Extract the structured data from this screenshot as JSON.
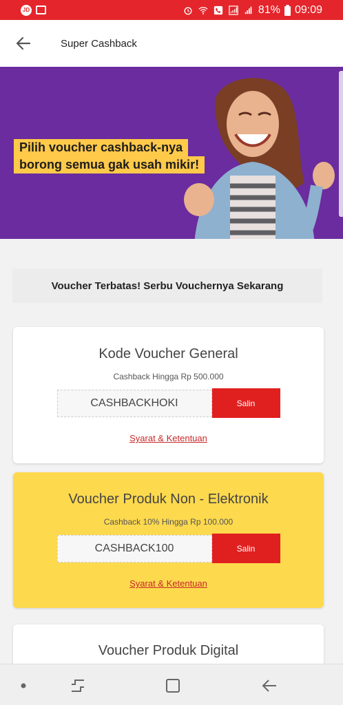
{
  "status_bar": {
    "left_badges": [
      "JD",
      ""
    ],
    "battery": "81%",
    "time": "09:09",
    "icons": [
      "alarm-icon",
      "wifi-icon",
      "phone-icon",
      "signal-icon",
      "battery-icon"
    ]
  },
  "header": {
    "title": "Super Cashback",
    "back_icon": "arrow-left-icon"
  },
  "banner": {
    "line1": "Pilih voucher cashback-nya",
    "line2": "borong semua gak usah mikir!",
    "colors": {
      "background": "#6a2c9e",
      "highlight": "#ffc94a"
    }
  },
  "info": {
    "text": "Voucher Terbatas! Serbu Vouchernya Sekarang"
  },
  "vouchers": [
    {
      "title": "Kode Voucher General",
      "subtitle": "Cashback Hingga Rp 500.000",
      "code": "CASHBACKHOKI",
      "button": "Salin",
      "terms": "Syarat & Ketentuan",
      "color": "#ffffff"
    },
    {
      "title": "Voucher Produk Non - Elektronik",
      "subtitle": "Cashback 10% Hingga Rp 100.000",
      "code": "CASHBACK100",
      "button": "Salin",
      "terms": "Syarat & Ketentuan",
      "color": "#fdd94e"
    },
    {
      "title": "Voucher Produk Digital"
    }
  ],
  "nav": {
    "items": [
      "dot-icon",
      "recents-icon",
      "home-icon",
      "back-icon"
    ]
  },
  "accent": "#e4252b"
}
